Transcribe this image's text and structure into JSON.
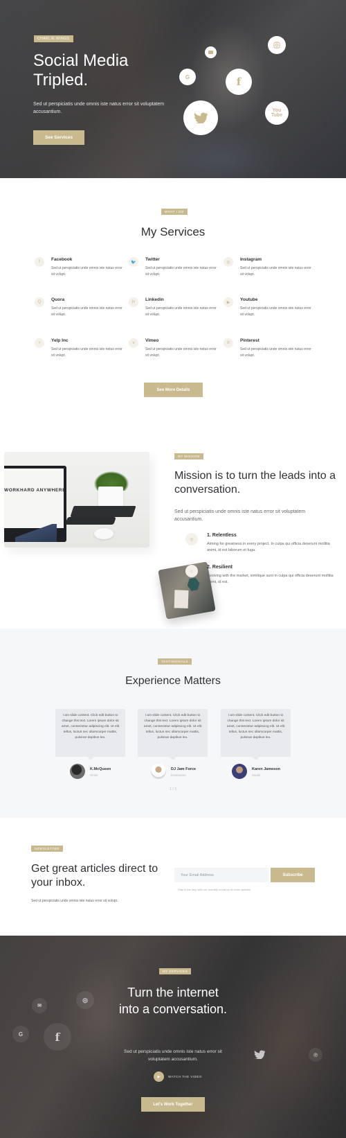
{
  "hero": {
    "tag": "Charlie Wings",
    "title": "Social Media Tripled.",
    "description": "Sed ut perspiciatis unde omnis iste natus error sit voluptatem accusantium.",
    "button": "See Services",
    "icons": [
      "instagram-icon",
      "email-icon",
      "google-icon",
      "facebook-icon",
      "youtube-icon",
      "twitter-icon"
    ]
  },
  "services": {
    "tag": "What I Do",
    "title": "My Services",
    "items": [
      {
        "name": "Facebook",
        "icon": "facebook-icon",
        "glyph": "f",
        "desc": "Sed ut perspiciatis unde omnis iste natus error sit volupt."
      },
      {
        "name": "Twitter",
        "icon": "twitter-icon",
        "glyph": "🐦",
        "desc": "Sed ut perspiciatis unde omnis iste natus error sit volupt."
      },
      {
        "name": "Instagram",
        "icon": "instagram-icon",
        "glyph": "◎",
        "desc": "Sed ut perspiciatis unde omnis iste natus error sit volupt."
      },
      {
        "name": "Quora",
        "icon": "quora-icon",
        "glyph": "Q",
        "desc": "Sed ut perspiciatis unde omnis iste natus error sit volupt."
      },
      {
        "name": "Linkedin",
        "icon": "linkedin-icon",
        "glyph": "in",
        "desc": "Sed ut perspiciatis unde omnis iste natus error sit volupt."
      },
      {
        "name": "Youtube",
        "icon": "youtube-icon",
        "glyph": "▶",
        "desc": "Sed ut perspiciatis unde omnis iste natus error sit volupt."
      },
      {
        "name": "Yelp Inc",
        "icon": "yelp-icon",
        "glyph": "ʏ",
        "desc": "Sed ut perspiciatis unde omnis iste natus error sit volupt."
      },
      {
        "name": "Vimeo",
        "icon": "vimeo-icon",
        "glyph": "v",
        "desc": "Sed ut perspiciatis unde omnis iste natus error sit volupt."
      },
      {
        "name": "Pinterest",
        "icon": "pinterest-icon",
        "glyph": "℗",
        "desc": "Sed ut perspiciatis unde omnis iste natus error sit volupt."
      }
    ],
    "button": "See More Details"
  },
  "mission": {
    "tag": "My Mission",
    "title": "Mission is to turn the leads into a conversation.",
    "lead": "Sed ut perspiciatis unde omnis iste natus error sit voluptatem accusantium.",
    "screen_word": "WORKHARD ANYWHERE",
    "points": [
      {
        "title": "1. Relentless",
        "desc": "Aiming for greatness in every project. In culpa qui officia deserunt mollitia animi, id est laborum et fuga."
      },
      {
        "title": "2. Resilient",
        "desc": "Evolving with the market, similique sunt in culpa qui officia deserunt mollitia animi, id est."
      }
    ]
  },
  "testimonials": {
    "tag": "Testimonials",
    "title": "Experience Matters",
    "cards": [
      {
        "quote": "I am slide content. Click edit button to change this text. Lorem ipsum dolor sit amet, consectetur adipiscing elit. Ut elit tellus, luctus nec ullamcorper mattis, pulvinar dapibus leo.",
        "name": "K.McQueen",
        "role": "Writer"
      },
      {
        "quote": "I am slide content. Click edit button to change this text. Lorem ipsum dolor sit amet, consectetur adipiscing elit. Ut elit tellus, luctus nec ullamcorper mattis, pulvinar dapibus leo.",
        "name": "DJ Jam Force",
        "role": "Entertainer"
      },
      {
        "quote": "I am slide content. Click edit button to change this text. Lorem ipsum dolor sit amet, consectetur adipiscing elit. Ut elit tellus, luctus nec ullamcorper mattis, pulvinar dapibus leo.",
        "name": "Karen Jameson",
        "role": "Model"
      }
    ],
    "pager": "1 / 3"
  },
  "newsletter": {
    "tag": "Newsletter",
    "title": "Get great articles direct to your inbox.",
    "sub": "Sed ut perspiciatis unde omnis iste natus error sit volupt.",
    "placeholder": "Your Email Address",
    "button": "Subscribe",
    "note": "Stay in the loop with our monthly round up of news updates."
  },
  "cta": {
    "tag": "My Services",
    "title": "Turn the internet into a conversation.",
    "desc": "Sed ut perspiciatis unde omnis iste natus error sit voluptatem accusantium.",
    "watch": "Watch the video",
    "button": "Let's Work Together",
    "icons": [
      "email-icon",
      "instagram-icon",
      "google-icon",
      "facebook-icon",
      "twitter-icon",
      "pinterest-icon"
    ]
  },
  "colors": {
    "accent": "#c8b98f",
    "text": "#2e3033",
    "muted": "#666666",
    "light_bg": "#f6f7f9"
  }
}
